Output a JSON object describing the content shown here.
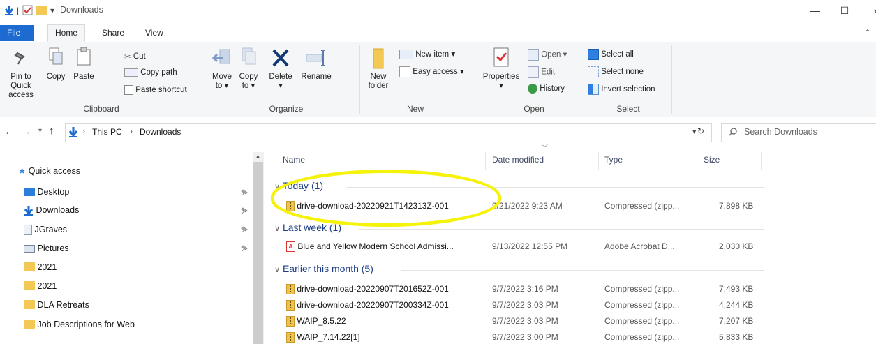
{
  "window": {
    "title": "Downloads",
    "controls": [
      "—",
      "☐",
      "✕"
    ]
  },
  "quick_access_toolbar": {
    "sep1": "|",
    "sep2": "|",
    "dropdown": "▾"
  },
  "ribbon_tabs": [
    "File",
    "Home",
    "Share",
    "View"
  ],
  "ribbon": {
    "clipboard": {
      "pin_label_1": "Pin to Quick",
      "pin_label_2": "access",
      "copy": "Copy",
      "paste": "Paste",
      "cut": "Cut",
      "copy_path": "Copy path",
      "paste_shortcut": "Paste shortcut",
      "group": "Clipboard"
    },
    "organize": {
      "move_to_1": "Move",
      "move_to_2": "to ▾",
      "copy_to_1": "Copy",
      "copy_to_2": "to ▾",
      "delete": "Delete",
      "delete_arrow": "▾",
      "rename": "Rename",
      "group": "Organize"
    },
    "new": {
      "new_folder_1": "New",
      "new_folder_2": "folder",
      "new_item": "New item ▾",
      "easy_access": "Easy access ▾",
      "group": "New"
    },
    "open": {
      "properties": "Properties",
      "properties_arrow": "▾",
      "open": "Open ▾",
      "edit": "Edit",
      "history": "History",
      "group": "Open"
    },
    "select": {
      "select_all": "Select all",
      "select_none": "Select none",
      "invert_selection": "Invert selection",
      "group": "Select"
    }
  },
  "address": {
    "back": "←",
    "forward": "→",
    "recent": "▾",
    "up": "↑",
    "crumb_sep": "›",
    "crumbs": [
      "This PC",
      "Downloads"
    ],
    "dropdown": "▾",
    "refresh": "↻",
    "search_placeholder": "Search Downloads"
  },
  "nav": {
    "quick_access": "Quick access",
    "items": [
      "Desktop",
      "Downloads",
      "JGraves",
      "Pictures",
      "2021",
      "2021",
      "DLA Retreats",
      "Job Descriptions for Web"
    ],
    "pin_glyph": "📌"
  },
  "columns": {
    "name": "Name",
    "date": "Date modified",
    "type": "Type",
    "size": "Size"
  },
  "groups": [
    {
      "label": "Today (1)"
    },
    {
      "label": "Last week (1)"
    },
    {
      "label": "Earlier this month (5)"
    }
  ],
  "files": {
    "today": [
      {
        "name": "drive-download-20220921T142313Z-001",
        "date": "9/21/2022 9:23 AM",
        "type": "Compressed (zipp...",
        "size": "7,898 KB"
      }
    ],
    "last_week": [
      {
        "name": "Blue and Yellow Modern School Admissi...",
        "date": "9/13/2022 12:55 PM",
        "type": "Adobe Acrobat D...",
        "size": "2,030 KB"
      }
    ],
    "earlier": [
      {
        "name": "drive-download-20220907T201652Z-001",
        "date": "9/7/2022 3:16 PM",
        "type": "Compressed (zipp...",
        "size": "7,493 KB"
      },
      {
        "name": "drive-download-20220907T200334Z-001",
        "date": "9/7/2022 3:03 PM",
        "type": "Compressed (zipp...",
        "size": "4,244 KB"
      },
      {
        "name": "WAIP_8.5.22",
        "date": "9/7/2022 3:03 PM",
        "type": "Compressed (zipp...",
        "size": "7,207 KB"
      },
      {
        "name": "WAIP_7.14.22[1]",
        "date": "9/7/2022 3:00 PM",
        "type": "Compressed (zipp...",
        "size": "5,833 KB"
      }
    ]
  },
  "colors": {
    "accent": "#1d6ad0",
    "highlight": "#f5f20c",
    "group_text": "#1f3f87"
  }
}
